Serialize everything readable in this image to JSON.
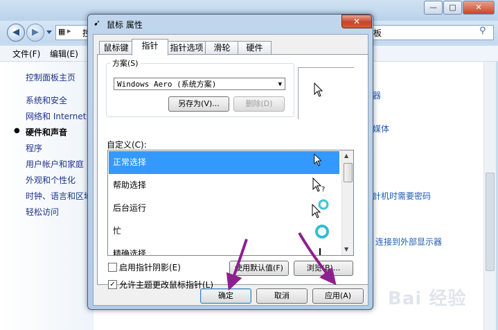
{
  "background_window": {
    "caption_buttons": {
      "minimize": "—",
      "maximize": "□",
      "close": "✕"
    },
    "nav": {
      "back": "◀",
      "forward": "▶"
    },
    "address_fragment": "控",
    "search_fragment": "板",
    "menu": [
      {
        "label": "文件(F)"
      },
      {
        "label": "编辑(E)"
      }
    ],
    "sidebar": [
      {
        "label": "控制面板主页"
      },
      {
        "label": "系统和安全"
      },
      {
        "label": "网络和 Internet"
      },
      {
        "label": "硬件和声音",
        "current": true
      },
      {
        "label": "程序"
      },
      {
        "label": "用户帐户和家庭"
      },
      {
        "label": "外观和个性化"
      },
      {
        "label": "时钟、语言和区域"
      },
      {
        "label": "轻松访问"
      }
    ],
    "main_fragments": [
      "器",
      "媒体",
      "計机时需要密码",
      "连接到外部显示器"
    ],
    "watermark": "Bai 经验"
  },
  "dialog": {
    "title": "鼠标 属性",
    "close_label": "✕",
    "tabs": [
      {
        "label": "鼠标键",
        "active": false
      },
      {
        "label": "指针",
        "active": true
      },
      {
        "label": "指针选项",
        "active": false
      },
      {
        "label": "滑轮",
        "active": false
      },
      {
        "label": "硬件",
        "active": false
      }
    ],
    "scheme": {
      "group_label": "方案(S)",
      "selected_value": "Windows Aero (系统方案)",
      "save_as_label": "另存为(V)...",
      "delete_label": "删除(D)"
    },
    "customize_label": "自定义(C):",
    "pointer_list": [
      {
        "label": "正常选择",
        "selected": true
      },
      {
        "label": "帮助选择",
        "selected": false
      },
      {
        "label": "后台运行",
        "selected": false
      },
      {
        "label": "忙",
        "selected": false
      },
      {
        "label": "精确选择",
        "selected": false
      }
    ],
    "enable_shadow": {
      "label": "启用指针阴影(E)",
      "checked": false
    },
    "use_default_label": "使用默认值(F)",
    "browse_label": "浏览(B)...",
    "allow_theme": {
      "label": "允许主题更改鼠标指针(L)",
      "checked": true
    },
    "ok_label": "确定",
    "cancel_label": "取消",
    "apply_label": "应用(A)"
  },
  "colors": {
    "selection": "#3399ff",
    "annotation_arrow": "#8e1f8e",
    "link": "#1e3287"
  }
}
